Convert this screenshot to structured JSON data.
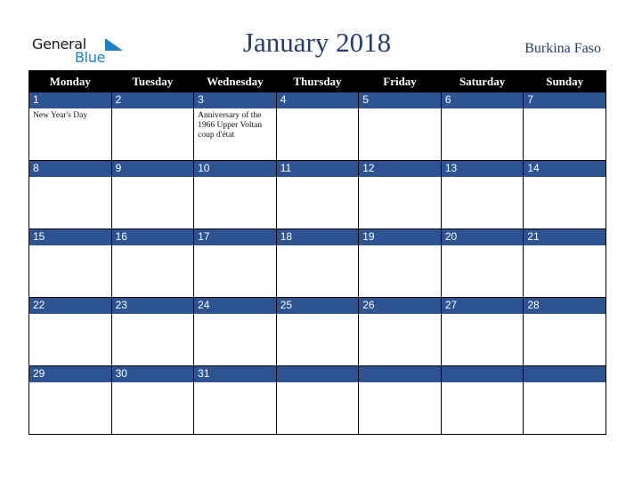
{
  "logo": {
    "line1": "General",
    "line2": "Blue",
    "accent_color": "#1f7fc4"
  },
  "title": "January 2018",
  "country": "Burkina Faso",
  "colors": {
    "header_bg": "#000000",
    "daynum_bg": "#2d5393",
    "title_color": "#253e6b"
  },
  "weekdays": [
    "Monday",
    "Tuesday",
    "Wednesday",
    "Thursday",
    "Friday",
    "Saturday",
    "Sunday"
  ],
  "weeks": [
    [
      {
        "day": "1",
        "event": "New Year's Day"
      },
      {
        "day": "2",
        "event": ""
      },
      {
        "day": "3",
        "event": "Anniversary of the 1966 Upper Voltan coup d'état"
      },
      {
        "day": "4",
        "event": ""
      },
      {
        "day": "5",
        "event": ""
      },
      {
        "day": "6",
        "event": ""
      },
      {
        "day": "7",
        "event": ""
      }
    ],
    [
      {
        "day": "8",
        "event": ""
      },
      {
        "day": "9",
        "event": ""
      },
      {
        "day": "10",
        "event": ""
      },
      {
        "day": "11",
        "event": ""
      },
      {
        "day": "12",
        "event": ""
      },
      {
        "day": "13",
        "event": ""
      },
      {
        "day": "14",
        "event": ""
      }
    ],
    [
      {
        "day": "15",
        "event": ""
      },
      {
        "day": "16",
        "event": ""
      },
      {
        "day": "17",
        "event": ""
      },
      {
        "day": "18",
        "event": ""
      },
      {
        "day": "19",
        "event": ""
      },
      {
        "day": "20",
        "event": ""
      },
      {
        "day": "21",
        "event": ""
      }
    ],
    [
      {
        "day": "22",
        "event": ""
      },
      {
        "day": "23",
        "event": ""
      },
      {
        "day": "24",
        "event": ""
      },
      {
        "day": "25",
        "event": ""
      },
      {
        "day": "26",
        "event": ""
      },
      {
        "day": "27",
        "event": ""
      },
      {
        "day": "28",
        "event": ""
      }
    ],
    [
      {
        "day": "29",
        "event": ""
      },
      {
        "day": "30",
        "event": ""
      },
      {
        "day": "31",
        "event": ""
      },
      {
        "day": "",
        "event": ""
      },
      {
        "day": "",
        "event": ""
      },
      {
        "day": "",
        "event": ""
      },
      {
        "day": "",
        "event": ""
      }
    ]
  ]
}
